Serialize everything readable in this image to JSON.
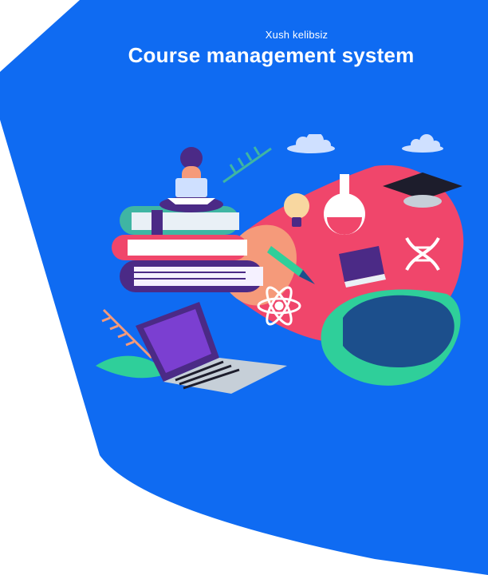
{
  "header": {
    "welcome_text": "Xush kelibsiz",
    "title": "Course management system"
  },
  "colors": {
    "brand_blue": "#0f6bf2",
    "background": "#ffffff",
    "blob_pink": "#f0466b",
    "blob_peach": "#f59a7a",
    "blob_teal": "#2fcf9a",
    "blob_navy": "#1c4f8c",
    "book_teal": "#3fb5a3",
    "book_white": "#e9f0f6",
    "purple": "#4b2a86"
  },
  "illustration": {
    "icons": [
      "woman-with-laptop-icon",
      "books-stack-icon",
      "laptop-icon",
      "flask-icon",
      "lightbulb-icon",
      "graduation-cap-icon",
      "dna-icon",
      "atom-icon",
      "book-icon",
      "pencil-icon",
      "cloud-icon",
      "leaf-icon"
    ]
  }
}
